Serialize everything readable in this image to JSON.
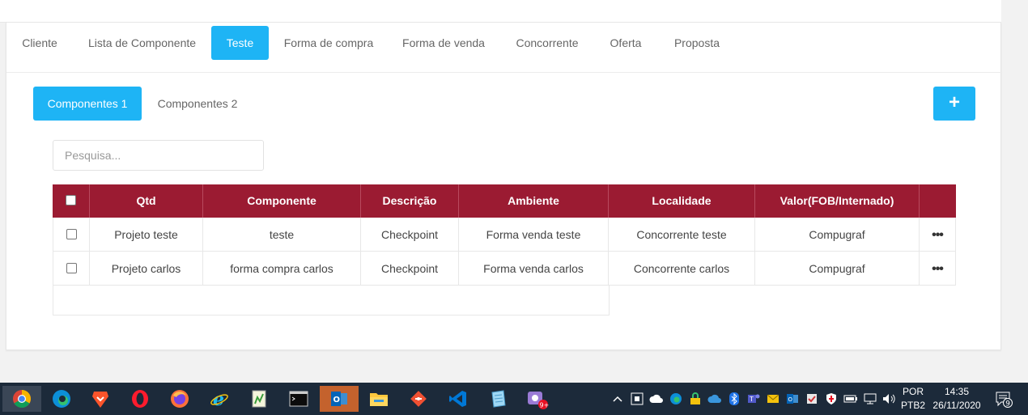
{
  "tabs": [
    {
      "label": "Cliente",
      "active": false
    },
    {
      "label": "Lista de Componente",
      "active": false
    },
    {
      "label": "Teste",
      "active": true
    },
    {
      "label": "Forma de compra",
      "active": false
    },
    {
      "label": "Forma de venda",
      "active": false
    },
    {
      "label": "Concorrente",
      "active": false
    },
    {
      "label": "Oferta",
      "active": false
    },
    {
      "label": "Proposta",
      "active": false
    }
  ],
  "subtabs": [
    {
      "label": "Componentes 1",
      "active": true
    },
    {
      "label": "Componentes 2",
      "active": false
    }
  ],
  "add_button": {
    "label": "+"
  },
  "search": {
    "placeholder": "Pesquisa...",
    "value": ""
  },
  "table": {
    "headers": [
      "Qtd",
      "Componente",
      "Descrição",
      "Ambiente",
      "Localidade",
      "Valor(FOB/Internado)"
    ],
    "rows": [
      {
        "checked": false,
        "cells": [
          "Projeto teste",
          "teste",
          "Checkpoint",
          "Forma venda teste",
          "Concorrente teste",
          "Compugraf"
        ],
        "menu": "•••"
      },
      {
        "checked": false,
        "cells": [
          "Projeto carlos",
          "forma compra carlos",
          "Checkpoint",
          "Forma venda carlos",
          "Concorrente carlos",
          "Compugraf"
        ],
        "menu": "•••"
      }
    ]
  },
  "colors": {
    "accent": "#1eb4f5",
    "header_bg": "#9b1b32",
    "taskbar_bg": "#1c2a3a"
  },
  "taskbar": {
    "apps": [
      "chrome-icon",
      "edge-icon",
      "brave-icon",
      "opera-icon",
      "firefox-icon",
      "ie-icon",
      "notepadpp-icon",
      "terminal-icon",
      "outlook-icon",
      "file-explorer-icon",
      "git-icon",
      "vscode-icon",
      "notepad-icon",
      "snip-icon"
    ],
    "badge": "9+",
    "tray_icons": [
      "chevron-up-icon",
      "action-icon",
      "cloud-icon",
      "edge-tray-icon",
      "lock-icon",
      "onedrive-icon",
      "bluetooth-icon",
      "teams-icon",
      "mail-icon",
      "outlook-tray-icon",
      "security-icon",
      "shield-icon",
      "battery-icon",
      "network-icon",
      "volume-icon"
    ],
    "lang_line1": "POR",
    "lang_line2": "PTB2",
    "time": "14:35",
    "date": "26/11/2020",
    "notification_count": "9"
  }
}
